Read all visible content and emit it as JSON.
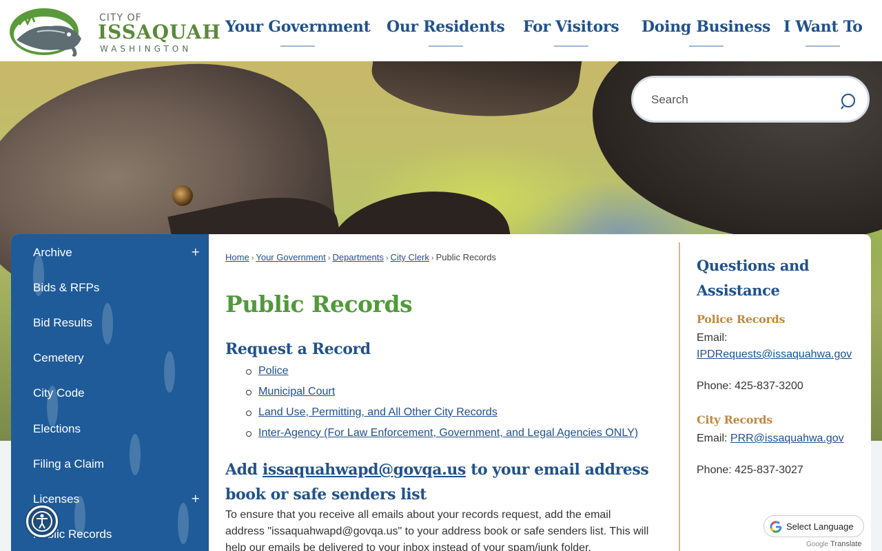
{
  "logo": {
    "city_of": "CITY OF",
    "name": "ISSAQUAH",
    "state": "WASHINGTON"
  },
  "nav": {
    "items": [
      {
        "label": "Your Government"
      },
      {
        "label": "Our Residents"
      },
      {
        "label": "For Visitors"
      },
      {
        "label": "Doing Business"
      },
      {
        "label": "I Want To"
      }
    ]
  },
  "search": {
    "placeholder": "Search"
  },
  "sidebar": {
    "items": [
      {
        "label": "Archive",
        "expandable": "+"
      },
      {
        "label": "Bids & RFPs"
      },
      {
        "label": "Bid Results"
      },
      {
        "label": "Cemetery"
      },
      {
        "label": "City Code"
      },
      {
        "label": "Elections"
      },
      {
        "label": "Filing a Claim"
      },
      {
        "label": "Licenses",
        "expandable": "+"
      },
      {
        "label": "Public Records"
      }
    ]
  },
  "breadcrumb": {
    "items": [
      "Home",
      "Your Government",
      "Departments",
      "City Clerk"
    ],
    "current": "Public Records",
    "separator": "›"
  },
  "main": {
    "title": "Public Records",
    "request_heading": "Request a Record",
    "links": [
      "Police",
      "Municipal Court",
      "Land Use, Permitting, and All Other City Records",
      "Inter-Agency (For Law Enforcement, Government, and Legal Agencies ONLY)"
    ],
    "add_heading_prefix": "Add ",
    "add_heading_email": "issaquahwapd@govqa.us",
    "add_heading_suffix": " to your email address book or safe senders list",
    "body": "To ensure that you receive all emails about your records request, add the email address \"issaquahwapd@govqa.us\" to your address book or safe senders list. This will help our emails be delivered to your inbox instead of your spam/junk folder."
  },
  "aside": {
    "title": "Questions and Assistance",
    "police": {
      "heading": "Police Records",
      "email_label": "Email:",
      "email": "IPDRequests@issaquahwa.gov",
      "phone": "Phone: 425-837-3200"
    },
    "city": {
      "heading": "City Records",
      "email_label": "Email:",
      "email": "PRR@issaquahwa.gov",
      "phone": "Phone: 425-837-3027"
    }
  },
  "translate": {
    "label": "Select Language",
    "powered_by": "Google",
    "powered_text": "Translate"
  },
  "colors": {
    "nav_blue": "#21528b",
    "title_green": "#4f9a3a",
    "sidebar_blue": "#1f5b99",
    "accent_gold": "#c0893e"
  }
}
